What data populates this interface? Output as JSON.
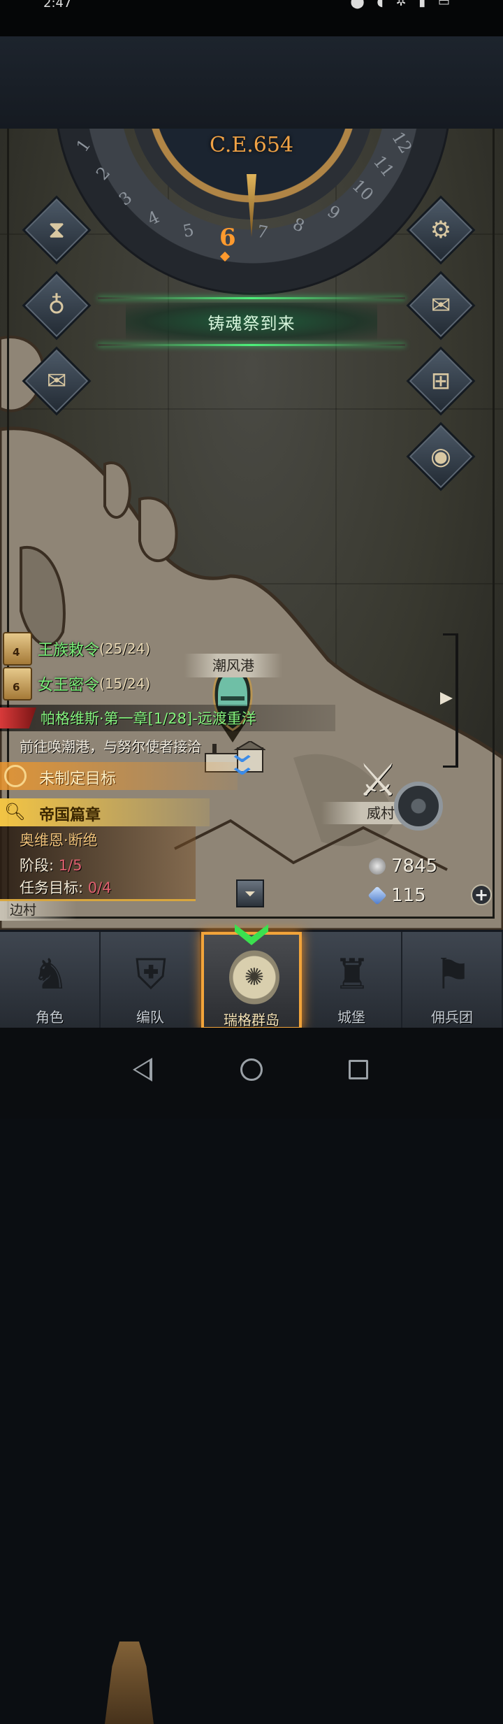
{
  "status_bar": {
    "time": "2:47",
    "icons": "⬤ ◖ ✲ ▮ ▭"
  },
  "calendar": {
    "era": "C.E.654",
    "months": [
      "1",
      "2",
      "3",
      "4",
      "5",
      "6",
      "7",
      "8",
      "9",
      "10",
      "11",
      "12"
    ],
    "current_month": "6"
  },
  "banner": {
    "text": "铸魂祭到来"
  },
  "side_buttons": {
    "left": [
      "hourglass-icon",
      "money-bag-icon",
      "scroll-icon"
    ],
    "right": [
      "gear-icon",
      "mail-icon",
      "window-icon",
      "coin-icon"
    ]
  },
  "map": {
    "port_label": "潮风港",
    "village_label": "威村",
    "edge_village_label": "边村"
  },
  "orders": [
    {
      "badge": "4",
      "name": "王族敕令",
      "count": "(25/24)"
    },
    {
      "badge": "6",
      "name": "女王密令",
      "count": "(15/24)"
    }
  ],
  "main_quest": {
    "title": "帕格维斯·第一章[1/28]-远渡重洋",
    "description": "前往唤潮港，与努尔使者接洽"
  },
  "goal": {
    "title": "未制定目标"
  },
  "campaign": {
    "title": "帝国篇章",
    "hero": "奥维恩·断绝",
    "stage_label": "阶段: ",
    "stage_value": "1/5",
    "target_label": "任务目标: ",
    "target_value": "0/4"
  },
  "resources": {
    "silver": "7845",
    "crystal": "115"
  },
  "bottom_nav": [
    {
      "label": "角色",
      "icon": "knight-icon"
    },
    {
      "label": "编队",
      "icon": "helmet-icon"
    },
    {
      "label": "瑞格群岛",
      "icon": "islands-icon",
      "active": true
    },
    {
      "label": "城堡",
      "icon": "castle-icon"
    },
    {
      "label": "佣兵团",
      "icon": "banner-icon"
    }
  ],
  "colors": {
    "accent_orange": "#f2a43a",
    "quest_green": "#86f47f",
    "banner_glow": "#4df07a"
  }
}
